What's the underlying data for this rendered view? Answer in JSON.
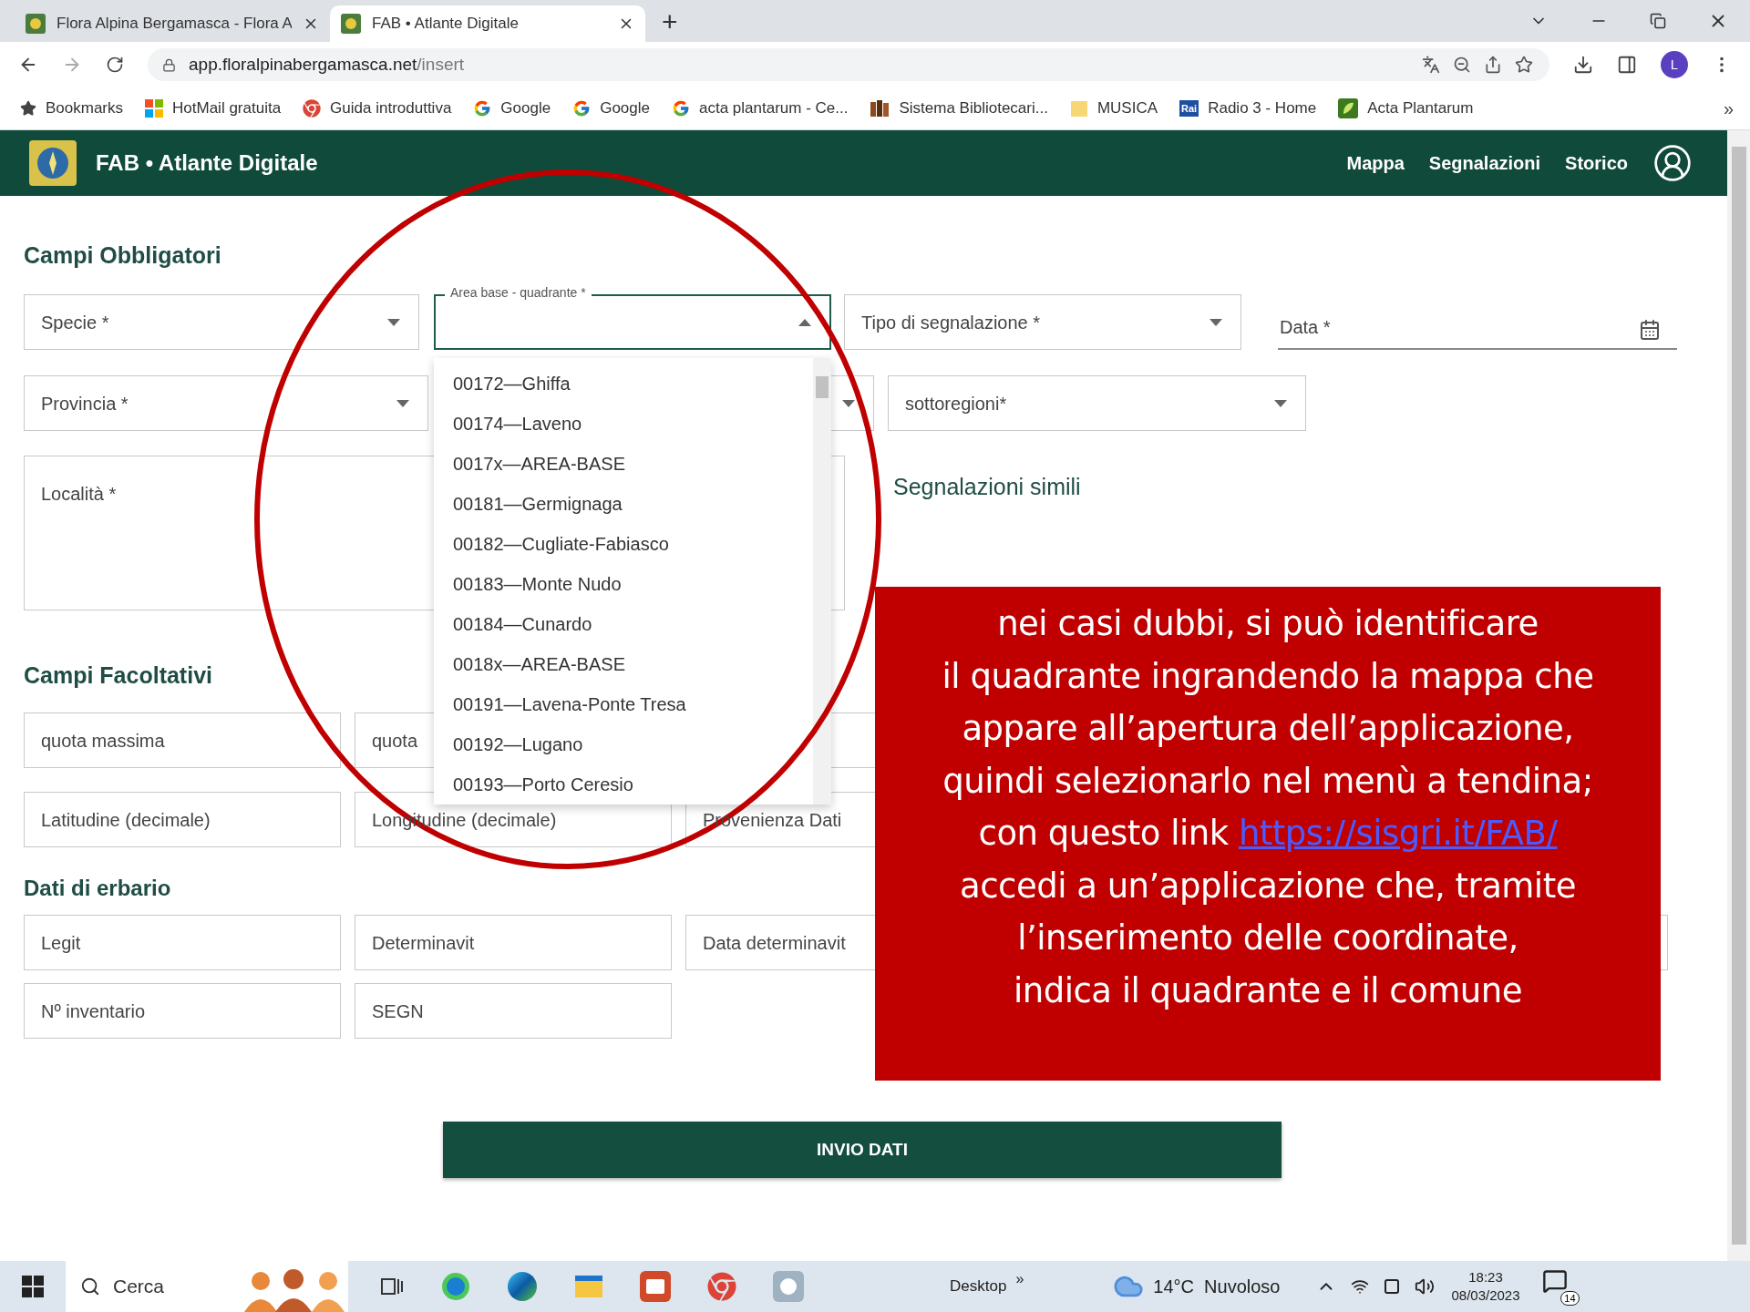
{
  "browser": {
    "tabs": [
      {
        "title": "Flora Alpina Bergamasca - Flora A",
        "selected": false
      },
      {
        "title": "FAB • Atlante Digitale",
        "selected": true
      }
    ],
    "new_tab": "+",
    "url_host": "app.floralpinabergamasca.net",
    "url_path": "/insert",
    "profile": "L",
    "bookmarks": [
      {
        "kind": "star",
        "label": "Bookmarks"
      },
      {
        "kind": "windows",
        "label": "HotMail gratuita"
      },
      {
        "kind": "chrome",
        "label": "Guida introduttiva"
      },
      {
        "kind": "google",
        "label": "Google"
      },
      {
        "kind": "google",
        "label": "Google"
      },
      {
        "kind": "google",
        "label": "acta plantarum - Ce..."
      },
      {
        "kind": "books",
        "label": "Sistema Bibliotecari..."
      },
      {
        "kind": "folder",
        "label": "MUSICA"
      },
      {
        "kind": "rai",
        "label": "Radio 3 - Home",
        "badge": "Rai"
      },
      {
        "kind": "acta",
        "label": "Acta Plantarum"
      }
    ],
    "more": "»"
  },
  "app": {
    "title": "FAB • Atlante Digitale",
    "nav": [
      "Mappa",
      "Segnalazioni",
      "Storico"
    ]
  },
  "form": {
    "required_heading": "Campi Obbligatori",
    "specie": "Specie *",
    "area_label": "Area base - quadrante *",
    "tipo": "Tipo di segnalazione *",
    "data": "Data *",
    "provincia": "Provincia *",
    "sottoregioni": "sottoregioni*",
    "localita": "Località *",
    "similar_heading": "Segnalazioni simili",
    "optional_heading": "Campi Facoltativi",
    "optional_row1": [
      {
        "kind": "text",
        "label": "quota massima"
      },
      {
        "kind": "text",
        "label": "quota"
      },
      {
        "kind": "blank"
      }
    ],
    "optional_row2": [
      {
        "kind": "text",
        "label": "Latitudine (decimale)"
      },
      {
        "kind": "text",
        "label": "Longitudine (decimale)"
      },
      {
        "kind": "text",
        "label": "Provenienza Dati"
      }
    ],
    "herbarium_heading": "Dati di erbario",
    "herbarium_row1": [
      {
        "kind": "text",
        "label": "Legit"
      },
      {
        "kind": "text",
        "label": "Determinavit"
      },
      {
        "kind": "text",
        "label": "Data determinavit"
      },
      {
        "kind": "blank"
      }
    ],
    "herbarium_row2": [
      {
        "kind": "text",
        "label": "Nº inventario"
      },
      {
        "kind": "text",
        "label": "SEGN"
      }
    ],
    "submit": "INVIO DATI"
  },
  "dropdown": {
    "options": [
      {
        "label": "00172—Ghiffa"
      },
      {
        "label": "00174—Laveno"
      },
      {
        "label": "0017x—AREA-BASE"
      },
      {
        "label": "00181—Germignaga"
      },
      {
        "label": "00182—Cugliate-Fabiasco"
      },
      {
        "label": "00183—Monte Nudo"
      },
      {
        "label": "00184—Cunardo"
      },
      {
        "label": "0018x—AREA-BASE"
      },
      {
        "label": "00191—Lavena-Ponte Tresa"
      },
      {
        "label": "00192—Lugano"
      },
      {
        "label": "00193—Porto Ceresio"
      }
    ]
  },
  "callout": {
    "lines_before": [
      "nei casi dubbi, si può identificare",
      "il quadrante ingrandendo la mappa che",
      "appare all’apertura dell’applicazione,",
      "quindi selezionarlo nel menù a tendina;"
    ],
    "link_prefix": "con questo link",
    "link": "https://sisgri.it/FAB/",
    "lines_after": [
      "accedi a un’applicazione che, tramite",
      "l’inserimento delle coordinate,",
      "indica il quadrante e il comune"
    ]
  },
  "taskbar": {
    "search": "Cerca",
    "desktop": "Desktop",
    "chevron": "»",
    "weather": "14°C  Nuvoloso",
    "time": "18:23",
    "date": "08/03/2023",
    "notifications": "14"
  }
}
